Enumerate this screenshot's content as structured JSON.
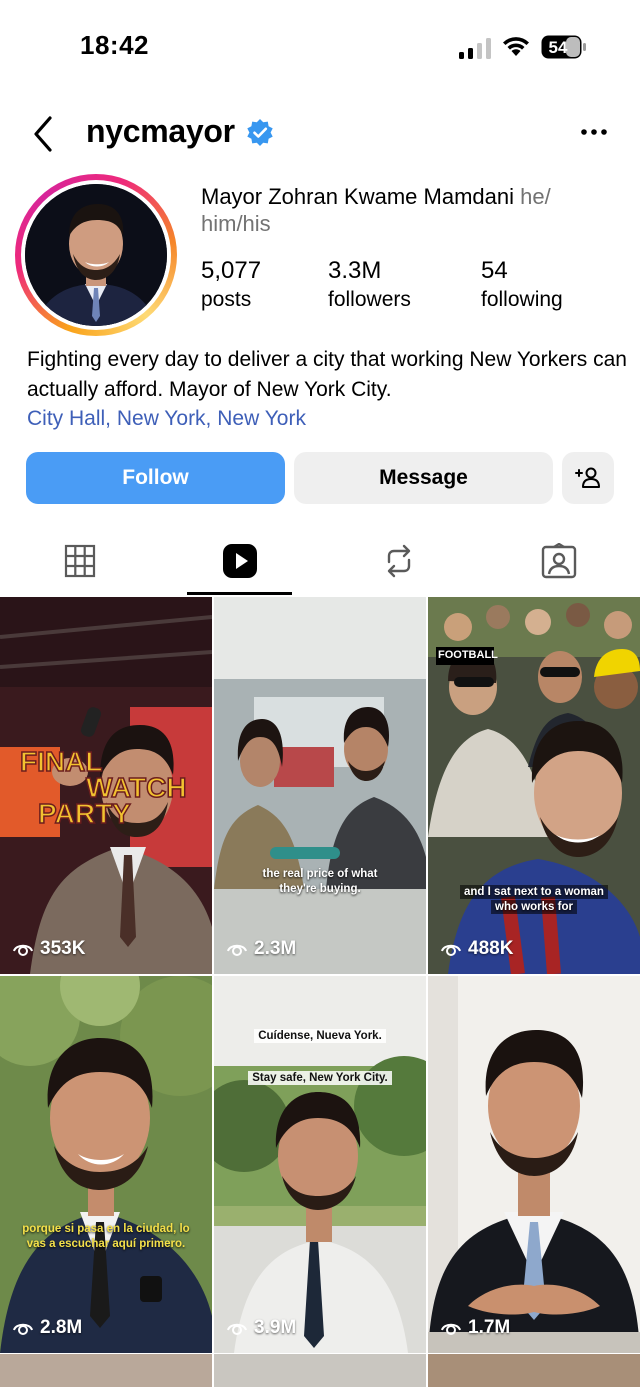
{
  "status_bar": {
    "time": "18:42",
    "battery_level": "54"
  },
  "header": {
    "username": "nycmayor",
    "verified": true
  },
  "profile": {
    "full_name": "Mayor Zohran Kwame Mamdani",
    "pronouns": "he/\nhim/his",
    "stats": [
      {
        "value": "5,077",
        "label": "posts"
      },
      {
        "value": "3.3M",
        "label": "followers"
      },
      {
        "value": "54",
        "label": "following"
      }
    ],
    "bio": "Fighting every day to deliver a city that working New Yorkers can actually afford. Mayor of New York City.",
    "location": "City Hall, New York, New York"
  },
  "actions": {
    "follow_label": "Follow",
    "message_label": "Message"
  },
  "tabs": [
    {
      "name": "posts-grid",
      "icon": "grid-icon",
      "active": false
    },
    {
      "name": "reels",
      "icon": "reels-icon",
      "active": true
    },
    {
      "name": "reposts",
      "icon": "repost-icon",
      "active": false
    },
    {
      "name": "tagged",
      "icon": "tagged-icon",
      "active": false
    }
  ],
  "reels": [
    {
      "views": "353K",
      "overlay": [
        "FINAL",
        "WATCH",
        "PARTY"
      ]
    },
    {
      "views": "2.3M",
      "caption": [
        "the real price of what",
        "they're buying."
      ]
    },
    {
      "views": "488K",
      "caption": [
        "and I sat next to a woman",
        "who works for"
      ],
      "badge": "FOOTBALL"
    },
    {
      "views": "2.8M",
      "caption": [
        "porque si pasa en la ciudad, lo",
        "vas a escuchar aquí primero."
      ]
    },
    {
      "views": "3.9M",
      "caption": [
        "Cuídense, Nueva York.",
        "Stay safe, New York City."
      ]
    },
    {
      "views": "1.7M"
    }
  ],
  "colors": {
    "follow_blue": "#4a9cf5",
    "location_link": "#3e5fb8",
    "verified_blue": "#3897f0"
  }
}
